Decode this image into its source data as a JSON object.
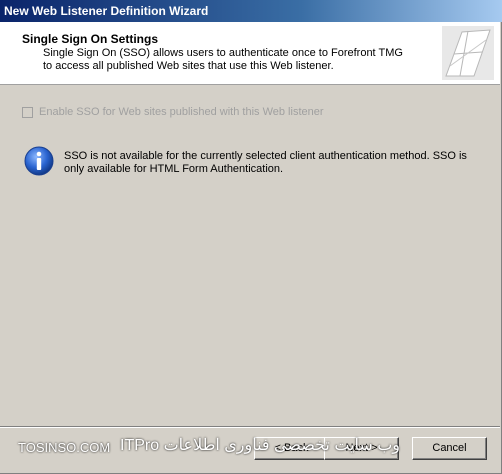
{
  "window": {
    "title": "New Web Listener Definition Wizard"
  },
  "header": {
    "title": "Single Sign On Settings",
    "description": "Single Sign On (SSO) allows users to authenticate once to Forefront TMG to access all published Web sites that use this Web listener."
  },
  "content": {
    "sso_checkbox_label": "Enable SSO for Web sites published with this Web listener",
    "sso_checkbox_checked": false,
    "sso_checkbox_enabled": false,
    "info_message": "SSO is not available for the currently selected client authentication method. SSO is only available for HTML Form Authentication."
  },
  "buttons": {
    "back": "< Back",
    "next": "Next >",
    "cancel": "Cancel"
  },
  "watermark": {
    "site": "TOSINSO.COM",
    "arabic": "وب سایت تخصصی فناوری اطلاعات",
    "brand": "ITPro"
  },
  "colors": {
    "titlebar_start": "#0a246a",
    "titlebar_end": "#a6caf0",
    "dialog_bg": "#d4d0c8",
    "header_bg": "#ffffff",
    "info_icon_blue": "#2060c0",
    "disabled_text": "#a0a0a0"
  }
}
